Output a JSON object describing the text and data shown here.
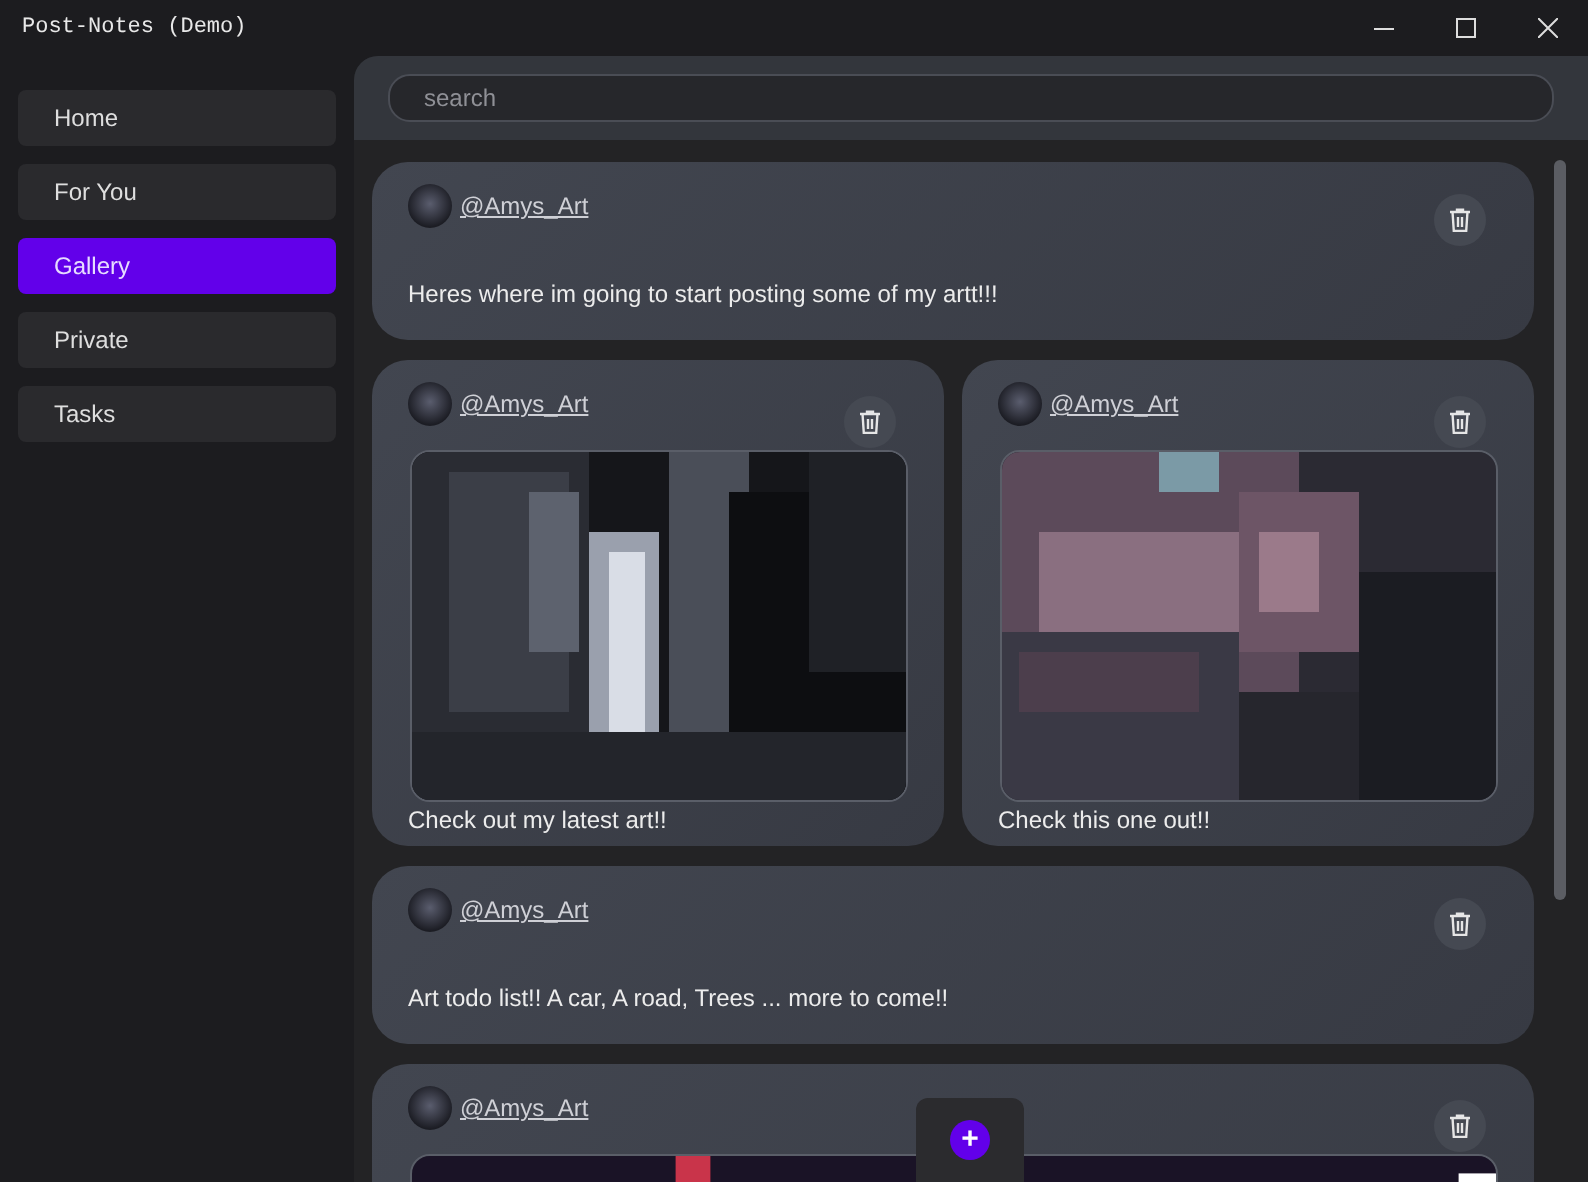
{
  "window": {
    "title": "Post-Notes (Demo)"
  },
  "sidebar": {
    "items": [
      {
        "label": "Home",
        "selected": false
      },
      {
        "label": "For You",
        "selected": false
      },
      {
        "label": "Gallery",
        "selected": true
      },
      {
        "label": "Private",
        "selected": false
      },
      {
        "label": "Tasks",
        "selected": false
      }
    ]
  },
  "search": {
    "placeholder": "search"
  },
  "feed": {
    "rows": [
      {
        "posts": [
          {
            "kind": "text",
            "author": "@Amys_Art",
            "text": "Heres where im going to start posting some of my artt!!!"
          }
        ]
      },
      {
        "posts": [
          {
            "author": "@Amys_Art",
            "caption": "Check out my latest art!!"
          },
          {
            "author": "@Amys_Art",
            "caption": "Check this one out!!"
          }
        ]
      },
      {
        "posts": [
          {
            "kind": "text",
            "author": "@Amys_Art",
            "text": "Art todo list!! A car, A road, Trees ... more to come!!"
          }
        ]
      },
      {
        "posts": [
          {
            "author": "@Amys_Art"
          }
        ]
      }
    ]
  },
  "fab": {
    "label": "+"
  }
}
